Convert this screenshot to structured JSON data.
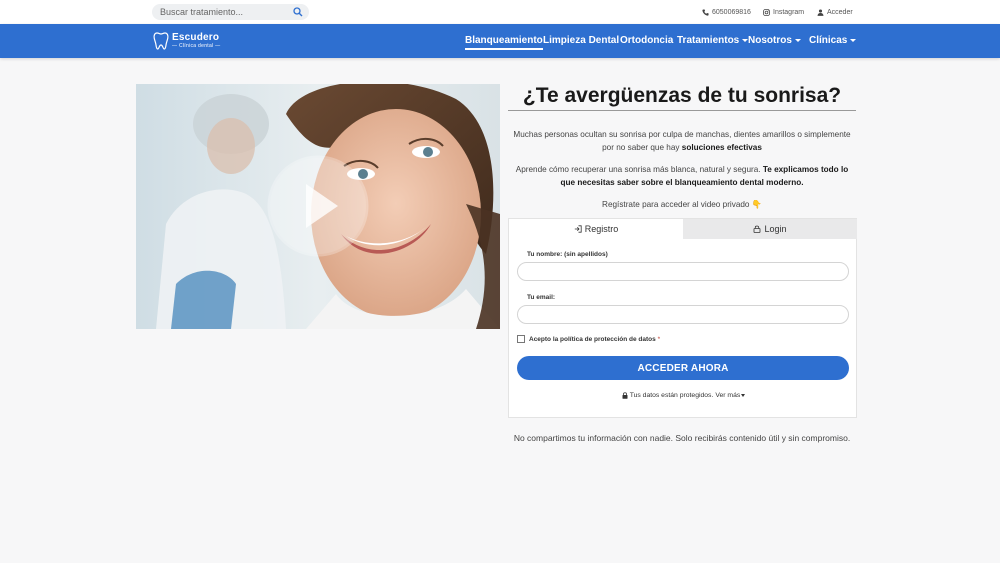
{
  "topbar": {
    "search_placeholder": "Buscar tratamiento...",
    "phone": "6050069816",
    "instagram": "Instagram",
    "login": "Acceder"
  },
  "brand": {
    "name": "Escudero",
    "subtitle": "— Clínica dental —"
  },
  "nav": {
    "items": [
      {
        "label": "Blanqueamiento"
      },
      {
        "label": "Limpieza Dental"
      },
      {
        "label": "Ortodoncia"
      },
      {
        "label": "Tratamientos"
      },
      {
        "label": "Nosotros"
      },
      {
        "label": "Clínicas"
      }
    ]
  },
  "main": {
    "title": "¿Te avergüenzas de tu sonrisa?",
    "p1_text": "Muchas personas ocultan su sonrisa por culpa de manchas, dientes amarillos o simplemente por no saber que hay ",
    "p1_bold": "soluciones efectivas",
    "p2_text": "Aprende cómo recuperar una sonrisa más blanca, natural y segura. ",
    "p2_bold": "Te explicamos todo lo que necesitas saber sobre el blanqueamiento dental moderno.",
    "p3": "Regístrate para acceder al video privado 👇"
  },
  "form": {
    "tab_register": "Registro",
    "tab_login": "Login",
    "name_label": "Tu nombre: (sin apellidos)",
    "email_label": "Tu email:",
    "consent_label": "Acepto la política de protección de datos",
    "consent_required": "*",
    "submit_label": "ACCEDER AHORA",
    "privacy_text": "Tus datos están protegidos.",
    "privacy_more": "Ver más"
  },
  "footnote": "No compartimos tu información con nadie. Solo recibirás contenido útil y sin compromiso.",
  "colors": {
    "accent": "#2e6fd0",
    "background": "#f7f7f8"
  }
}
